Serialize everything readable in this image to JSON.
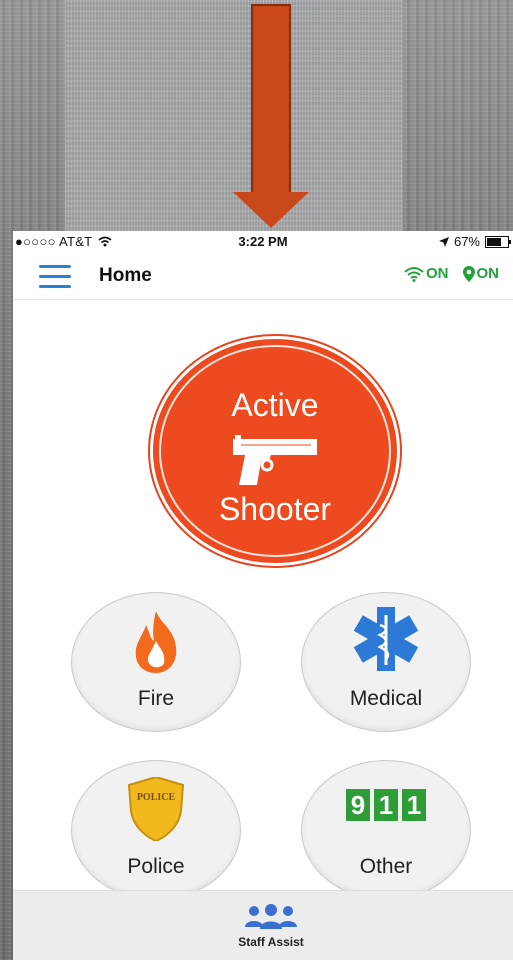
{
  "status_bar": {
    "carrier": "●○○○○ AT&T",
    "time": "3:22 PM",
    "battery": "67%"
  },
  "nav": {
    "title": "Home",
    "wifi_status": "ON",
    "location_status": "ON"
  },
  "main_button": {
    "label_top": "Active",
    "label_bottom": "Shooter",
    "icon": "pistol-icon"
  },
  "buttons": [
    {
      "label": "Fire",
      "icon": "flame-icon"
    },
    {
      "label": "Medical",
      "icon": "star-of-life-icon"
    },
    {
      "label": "Police",
      "icon": "police-badge-icon",
      "badge_text": "POLICE"
    },
    {
      "label": "Other",
      "icon": "911-icon",
      "digits": [
        "9",
        "1",
        "1"
      ]
    }
  ],
  "bottom_tab": {
    "label": "Staff Assist",
    "icon": "people-group-icon"
  },
  "colors": {
    "accent_red": "#ee4a1f",
    "status_green": "#22a33a",
    "menu_blue": "#2a7fd6",
    "arrow": "#c9481b"
  }
}
